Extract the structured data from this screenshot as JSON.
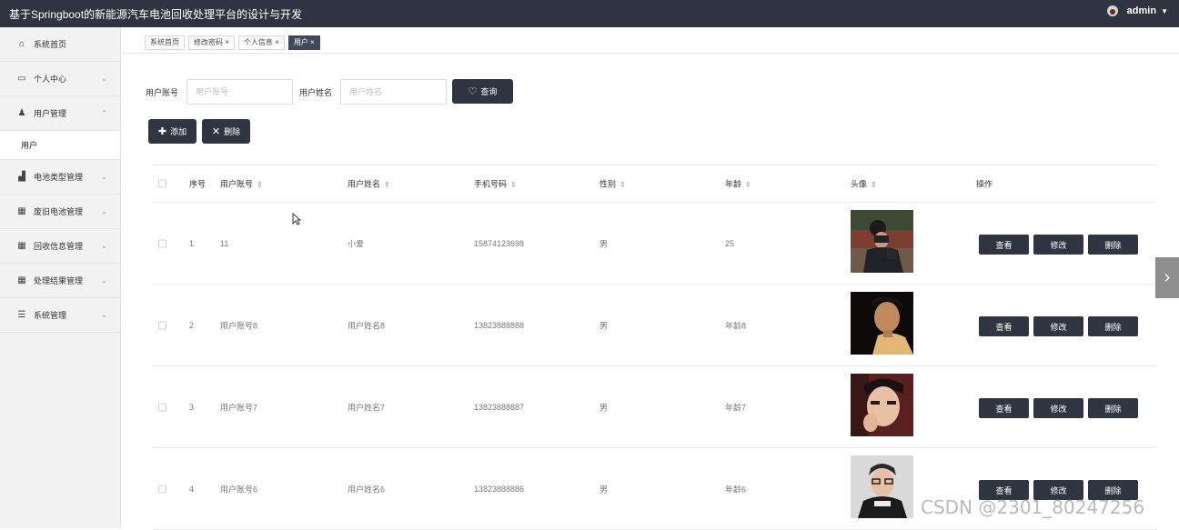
{
  "header": {
    "title": "基于Springboot的新能源汽车电池回收处理平台的设计与开发",
    "user": "admin"
  },
  "sidebar": {
    "items": [
      {
        "label": "系统首页",
        "icon": "home-icon",
        "glyph": "⌂",
        "chevron": ""
      },
      {
        "label": "个人中心",
        "icon": "profile-card-icon",
        "glyph": "▭",
        "chevron": "⌄"
      },
      {
        "label": "用户管理",
        "icon": "user-icon",
        "glyph": "♟",
        "chevron": "⌃"
      },
      {
        "label": "电池类型管理",
        "icon": "thumb-icon",
        "glyph": "▟",
        "chevron": "⌄"
      },
      {
        "label": "废旧电池管理",
        "icon": "grid-icon",
        "glyph": "▦",
        "chevron": "⌄"
      },
      {
        "label": "回收信息管理",
        "icon": "grid-icon",
        "glyph": "▦",
        "chevron": "⌄"
      },
      {
        "label": "处理结果管理",
        "icon": "table-icon",
        "glyph": "▦",
        "chevron": "⌄"
      },
      {
        "label": "系统管理",
        "icon": "list-icon",
        "glyph": "☰",
        "chevron": "⌄"
      }
    ],
    "subitem": "用户"
  },
  "tabs": [
    "系统首页",
    "修改密码",
    "个人信息",
    "用户"
  ],
  "search": {
    "account_label": "用户账号",
    "account_placeholder": "用户账号",
    "name_label": "用户姓名",
    "name_placeholder": "用户姓名",
    "query_label": "查询"
  },
  "actions": {
    "add": "添加",
    "delete": "删除"
  },
  "table": {
    "headers": {
      "index": "序号",
      "account": "用户账号",
      "name": "用户姓名",
      "phone": "手机号码",
      "gender": "性别",
      "age": "年龄",
      "avatar": "头像",
      "ops": "操作"
    },
    "rows": [
      {
        "index": "1",
        "account": "11",
        "name": "小爱",
        "phone": "15874123698",
        "gender": "男",
        "age": "25"
      },
      {
        "index": "2",
        "account": "用户账号8",
        "name": "用户姓名8",
        "phone": "13823888888",
        "gender": "男",
        "age": "年龄8"
      },
      {
        "index": "3",
        "account": "用户账号7",
        "name": "用户姓名7",
        "phone": "13823888887",
        "gender": "男",
        "age": "年龄7"
      },
      {
        "index": "4",
        "account": "用户账号6",
        "name": "用户姓名6",
        "phone": "13823888886",
        "gender": "男",
        "age": "年龄6"
      }
    ],
    "op_view": "查看",
    "op_edit": "修改",
    "op_delete": "删除"
  },
  "watermark": "CSDN @2301_80247256"
}
